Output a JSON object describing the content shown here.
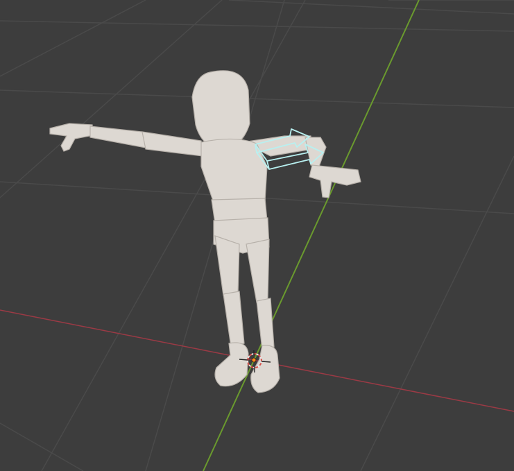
{
  "viewport": {
    "view": "3d-viewport",
    "shading": "solid",
    "colors": {
      "background": "#3d3d3d",
      "grid": "#4a4a4a",
      "x_axis": "#9b3a45",
      "y_axis": "#6a9a2e",
      "mesh": "#ddd8d2",
      "selection_outline": "#b8f0f0",
      "origin": "#ff8a1a"
    }
  },
  "objects": [
    {
      "name": "mannequin",
      "type": "mesh",
      "selected": false
    },
    {
      "name": "upper-arm-bone",
      "type": "armature-bone",
      "selected": true
    }
  ],
  "icons": {
    "cursor": "3d-cursor-icon",
    "origin": "object-origin-icon"
  }
}
